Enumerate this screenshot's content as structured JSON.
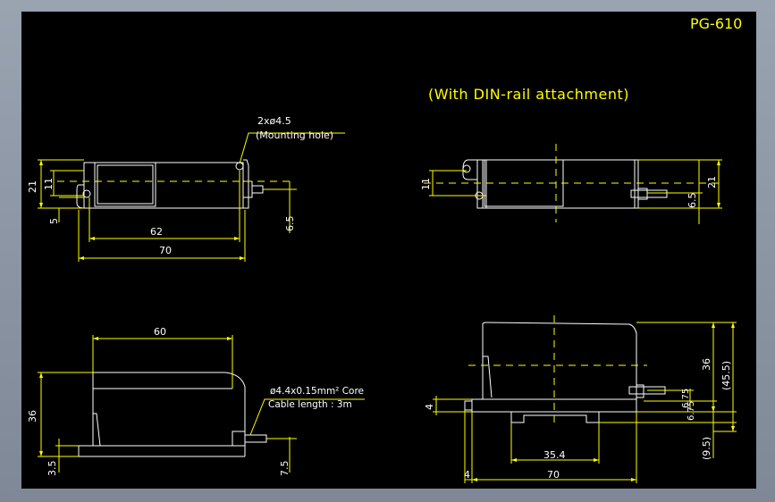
{
  "title": "PG-610",
  "subtitle": "(With DIN-rail attachment)",
  "colors": {
    "background": "#000000",
    "frame": "#9aa4b1",
    "outline": "#ffffff",
    "dimension": "#ffff00",
    "centerline": "#ffff00"
  },
  "top_left": {
    "note_hole_count": "2xø4.5",
    "note_hole_name": "(Mounting hole)",
    "dim_height": "21",
    "dim_center": "11",
    "dim_offset": "5",
    "dim_hole_spacing": "62",
    "dim_length": "70",
    "dim_cable": "6.5"
  },
  "top_right": {
    "dim_center": "11",
    "dim_cable": "6.5",
    "dim_height": "21"
  },
  "bottom_left": {
    "dim_top_length": "60",
    "dim_height": "36",
    "dim_base": "3.5",
    "dim_cable": "7.5",
    "note_cable_core": "ø4.4x0.15mm² Core",
    "note_cable_length": "Cable length : 3m"
  },
  "bottom_right": {
    "dim_height": "36",
    "dim_total": "(45.5)",
    "dim_c1": "6.75",
    "dim_c2": "6.75",
    "dim_rail": "(9.5)",
    "dim_left": "4",
    "dim_rail_width": "35.4",
    "dim_length": "70",
    "dim_base": "4"
  }
}
